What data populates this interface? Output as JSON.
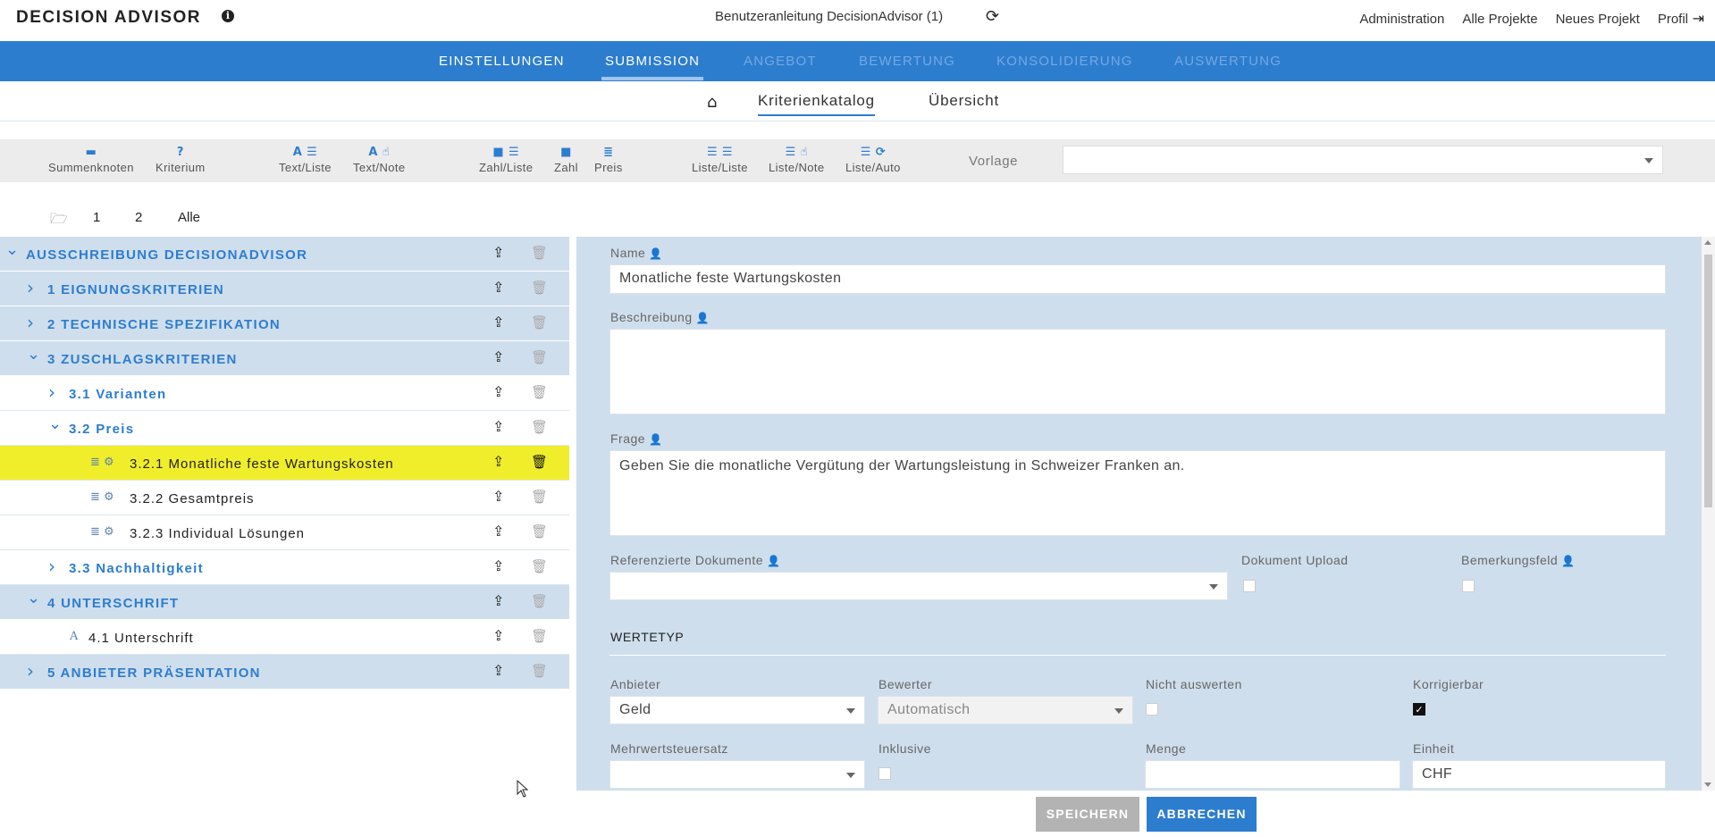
{
  "app": {
    "brand": "DECISION ADVISOR",
    "doc_title": "Benutzeranleitung DecisionAdvisor (1)"
  },
  "top_links": [
    "Administration",
    "Alle Projekte",
    "Neues Projekt",
    "Profil"
  ],
  "main_tabs": [
    {
      "label": "EINSTELLUNGEN",
      "state": "normal"
    },
    {
      "label": "SUBMISSION",
      "state": "active"
    },
    {
      "label": "ANGEBOT",
      "state": "disabled"
    },
    {
      "label": "BEWERTUNG",
      "state": "disabled"
    },
    {
      "label": "KONSOLIDIERUNG",
      "state": "disabled"
    },
    {
      "label": "AUSWERTUNG",
      "state": "disabled"
    }
  ],
  "sub_tabs": [
    "Kriterienkatalog",
    "Übersicht"
  ],
  "toolbar": {
    "tools": [
      "Summenknoten",
      "Kriterium",
      "Text/Liste",
      "Text/Note",
      "Zahl/Liste",
      "Zahl",
      "Preis",
      "Liste/Liste",
      "Liste/Note",
      "Liste/Auto"
    ],
    "vorlage_label": "Vorlage",
    "vorlage_value": ""
  },
  "levels": [
    "1",
    "2",
    "Alle"
  ],
  "tree": [
    {
      "label": "AUSSCHREIBUNG DECISIONADVISOR",
      "type": "group",
      "depth": 0,
      "expanded": true
    },
    {
      "label": "1 EIGNUNGSKRITERIEN",
      "type": "group",
      "depth": 1,
      "expanded": false
    },
    {
      "label": "2 TECHNISCHE SPEZIFIKATION",
      "type": "group",
      "depth": 1,
      "expanded": false
    },
    {
      "label": "3 ZUSCHLAGSKRITERIEN",
      "type": "group",
      "depth": 1,
      "expanded": true
    },
    {
      "label": "3.1 Varianten",
      "type": "node",
      "depth": 2,
      "expanded": false
    },
    {
      "label": "3.2 Preis",
      "type": "node",
      "depth": 2,
      "expanded": true
    },
    {
      "label": "3.2.1 Monatliche feste Wartungskosten",
      "type": "leaf",
      "depth": 3,
      "selected": true
    },
    {
      "label": "3.2.2 Gesamtpreis",
      "type": "leaf",
      "depth": 3
    },
    {
      "label": "3.2.3 Individual Lösungen",
      "type": "leaf",
      "depth": 3
    },
    {
      "label": "3.3 Nachhaltigkeit",
      "type": "node",
      "depth": 2,
      "expanded": false
    },
    {
      "label": "4 UNTERSCHRIFT",
      "type": "group",
      "depth": 1,
      "expanded": true
    },
    {
      "label": "4.1 Unterschrift",
      "type": "textleaf",
      "depth": 2
    },
    {
      "label": "5 ANBIETER PRÄSENTATION",
      "type": "group",
      "depth": 1,
      "expanded": false
    }
  ],
  "form": {
    "name_label": "Name",
    "name_value": "Monatliche feste Wartungskosten",
    "beschreibung_label": "Beschreibung",
    "beschreibung_value": "",
    "frage_label": "Frage",
    "frage_value": "Geben Sie die monatliche Vergütung der Wartungsleistung in Schweizer Franken an.",
    "ref_docs_label": "Referenzierte Dokumente",
    "ref_docs_value": "",
    "doc_upload_label": "Dokument Upload",
    "bemerkung_label": "Bemerkungsfeld",
    "wertetyp_title": "WERTETYP",
    "anbieter_label": "Anbieter",
    "anbieter_value": "Geld",
    "bewerter_label": "Bewerter",
    "bewerter_value": "Automatisch",
    "nicht_auswerten_label": "Nicht auswerten",
    "korrigierbar_label": "Korrigierbar",
    "mwst_label": "Mehrwertsteuersatz",
    "mwst_value": "",
    "inklusive_label": "Inklusive",
    "menge_label": "Menge",
    "menge_value": "",
    "einheit_label": "Einheit",
    "einheit_value": "CHF"
  },
  "buttons": {
    "save": "SPEICHERN",
    "cancel": "ABBRECHEN"
  }
}
